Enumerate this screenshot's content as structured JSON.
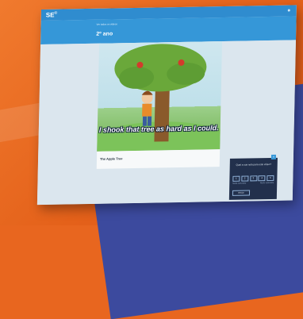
{
  "app": {
    "logo": "SE",
    "logo_sup": "©"
  },
  "header": {
    "breadcrumb": "Ver todos os vídeos",
    "grade": "2º ano"
  },
  "video": {
    "subtitle": "I shook that tree as hard as I could.",
    "title": "The Apple Tree"
  },
  "feedback": {
    "close_label": "×",
    "question": "Qual a sua nota para este vídeo?",
    "ratings": [
      "1",
      "2",
      "3",
      "4",
      "5"
    ],
    "scale_low": "Nada relevante",
    "scale_high": "Muito relevante",
    "send_label": "Enviar"
  },
  "colors": {
    "topbar": "#2f8ccf",
    "subbar": "#3597d8",
    "widget": "#22304c",
    "background_orange": "#e8661f",
    "background_blue": "#3c4a9e"
  }
}
